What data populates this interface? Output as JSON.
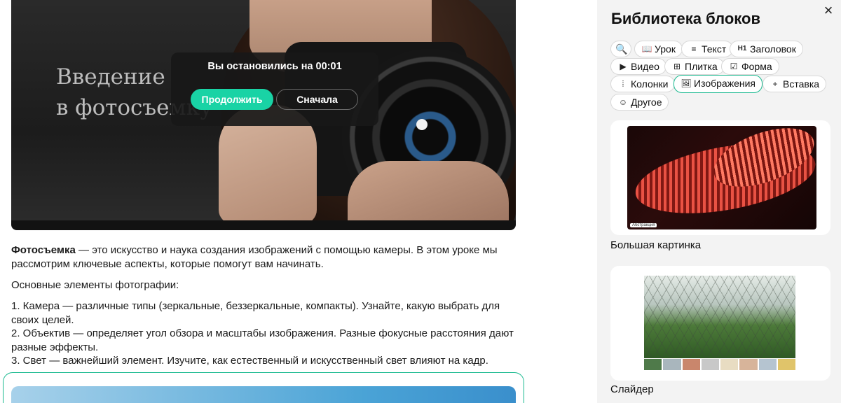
{
  "video": {
    "board_text": "Введение\nв фотосъемку",
    "resume_title": "Вы остановились на 00:01",
    "continue_label": "Продолжить",
    "restart_label": "Сначала"
  },
  "article": {
    "lead_bold": "Фотосъемка",
    "lead_rest": " — это искусство и наука создания изображений с помощью камеры. В этом уроке мы рассмотрим ключевые аспекты, которые помогут вам начинать.",
    "subtitle": "Основные элементы фотографии:",
    "items": [
      "1. Камера — различные типы (зеркальные, беззеркальные, компакты). Узнайте, какую выбрать для своих целей.",
      "2. Объектив — определяет угол обзора и масштабы изображения. Разные фокусные расстояния дают разные эффекты.",
      "3. Свет — важнейший элемент. Изучите, как естественный и искусственный свет влияют на кадр."
    ]
  },
  "panel": {
    "title": "Библиотека блоков",
    "close_icon": "×",
    "chips": [
      {
        "label": "",
        "icon": "🔍",
        "icon_name": "search-icon"
      },
      {
        "label": "Урок",
        "icon": "📖",
        "icon_name": "book-icon"
      },
      {
        "label": "Текст",
        "icon": "≡",
        "icon_name": "text-icon"
      },
      {
        "label": "Заголовок",
        "icon": "H1",
        "icon_name": "heading-icon"
      },
      {
        "label": "Видео",
        "icon": "▶",
        "icon_name": "video-icon"
      },
      {
        "label": "Плитка",
        "icon": "⊞",
        "icon_name": "tiles-icon"
      },
      {
        "label": "Форма",
        "icon": "☑",
        "icon_name": "form-icon"
      },
      {
        "label": "Колонки",
        "icon": "⦙",
        "icon_name": "columns-icon"
      },
      {
        "label": "Изображения",
        "icon": "🖼",
        "icon_name": "image-icon"
      },
      {
        "label": "Вставка",
        "icon": "+",
        "icon_name": "plus-icon"
      },
      {
        "label": "Другое",
        "icon": "☺",
        "icon_name": "other-icon"
      }
    ],
    "active_chip": "Изображения",
    "cards": [
      {
        "label": "Большая картинка",
        "caption": "Абстракция"
      },
      {
        "label": "Слайдер"
      }
    ]
  },
  "colors": {
    "accent": "#19d3a5",
    "accent_border": "#19b98f",
    "panel_bg": "#f3f3f3"
  }
}
